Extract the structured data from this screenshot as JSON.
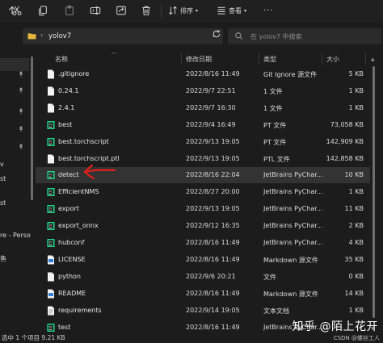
{
  "toolbar": {
    "sort_label": "排序",
    "view_label": "查看",
    "more_label": "···",
    "icons": [
      "cut-icon",
      "copy-icon",
      "paste-icon",
      "rename-icon",
      "share-icon",
      "delete-icon"
    ]
  },
  "address": {
    "crumb": "yolov7",
    "search_placeholder": "在 yolov7 中搜索"
  },
  "leftnav": {
    "items": [
      {
        "label": "",
        "pinned": true
      },
      {
        "label": "",
        "pinned": true
      },
      {
        "label": "",
        "pinned": true
      },
      {
        "label": "",
        "pinned": true
      },
      {
        "label": "",
        "pinned": true
      },
      {
        "label": "v",
        "pinned": false
      },
      {
        "label": "st",
        "pinned": false
      },
      {
        "label": "st",
        "pinned": false
      },
      {
        "label": "re - Perso",
        "pinned": false
      },
      {
        "label": "鱼",
        "pinned": false
      }
    ]
  },
  "columns": {
    "name": "名称",
    "date": "修改日期",
    "type": "类型",
    "size": "大小"
  },
  "files": [
    {
      "name": ".gitignore",
      "date": "2022/8/16 11:49",
      "type": "Git Ignore 源文件",
      "size": "5 KB",
      "icon": "doc-icon",
      "selected": false
    },
    {
      "name": "0.24.1",
      "date": "2022/9/7 22:51",
      "type": "1 文件",
      "size": "1 KB",
      "icon": "doc-icon",
      "selected": false
    },
    {
      "name": "2.4.1",
      "date": "2022/9/7 16:30",
      "type": "1 文件",
      "size": "1 KB",
      "icon": "doc-icon",
      "selected": false
    },
    {
      "name": "best",
      "date": "2022/9/4 16:49",
      "type": "PT 文件",
      "size": "73,058 KB",
      "icon": "pycharm-icon",
      "selected": false
    },
    {
      "name": "best.torchscript",
      "date": "2022/9/13 19:05",
      "type": "PT 文件",
      "size": "142,909 KB",
      "icon": "pycharm-icon",
      "selected": false
    },
    {
      "name": "best.torchscript.ptl",
      "date": "2022/9/13 19:05",
      "type": "PTL 文件",
      "size": "142,858 KB",
      "icon": "doc-icon",
      "selected": false
    },
    {
      "name": "detect",
      "date": "2022/8/16 22:04",
      "type": "JetBrains PyChar...",
      "size": "10 KB",
      "icon": "pycharm-icon",
      "selected": true
    },
    {
      "name": "EfficientNMS",
      "date": "2022/8/27 20:00",
      "type": "JetBrains PyChar...",
      "size": "1 KB",
      "icon": "pycharm-icon",
      "selected": false
    },
    {
      "name": "export",
      "date": "2022/9/13 19:05",
      "type": "JetBrains PyChar...",
      "size": "11 KB",
      "icon": "pycharm-icon",
      "selected": false
    },
    {
      "name": "export_onnx",
      "date": "2022/9/12 16:35",
      "type": "JetBrains PyChar...",
      "size": "2 KB",
      "icon": "pycharm-icon",
      "selected": false
    },
    {
      "name": "hubconf",
      "date": "2022/8/16 11:49",
      "type": "JetBrains PyChar...",
      "size": "4 KB",
      "icon": "pycharm-icon",
      "selected": false
    },
    {
      "name": "LICENSE",
      "date": "2022/8/16 11:49",
      "type": "Markdown 源文件",
      "size": "35 KB",
      "icon": "markdown-icon",
      "selected": false
    },
    {
      "name": "python",
      "date": "2022/9/6 20:21",
      "type": "文件",
      "size": "0 KB",
      "icon": "doc-icon",
      "selected": false
    },
    {
      "name": "README",
      "date": "2022/8/16 11:49",
      "type": "Markdown 源文件",
      "size": "14 KB",
      "icon": "markdown-icon",
      "selected": false
    },
    {
      "name": "requirements",
      "date": "2022/9/14 19:05",
      "type": "文本文档",
      "size": "1 KB",
      "icon": "text-icon",
      "selected": false
    },
    {
      "name": "test",
      "date": "2022/8/16 11:49",
      "type": "JetBrains PyChar...",
      "size": "",
      "icon": "pycharm-icon",
      "selected": false
    }
  ],
  "status": {
    "text": "选中 1 个项目 9.21 KB"
  },
  "watermark": {
    "big": "知乎 @陌上花开",
    "small": "CSDN @螺丝工人"
  },
  "colors": {
    "background": "#1c1c1c",
    "selected_row": "#333333",
    "pycharm_green": "#21d789",
    "markdown_blue": "#2f7fd6",
    "annotation_red": "#e0201b",
    "folder_yellow": "#e8b83c"
  }
}
